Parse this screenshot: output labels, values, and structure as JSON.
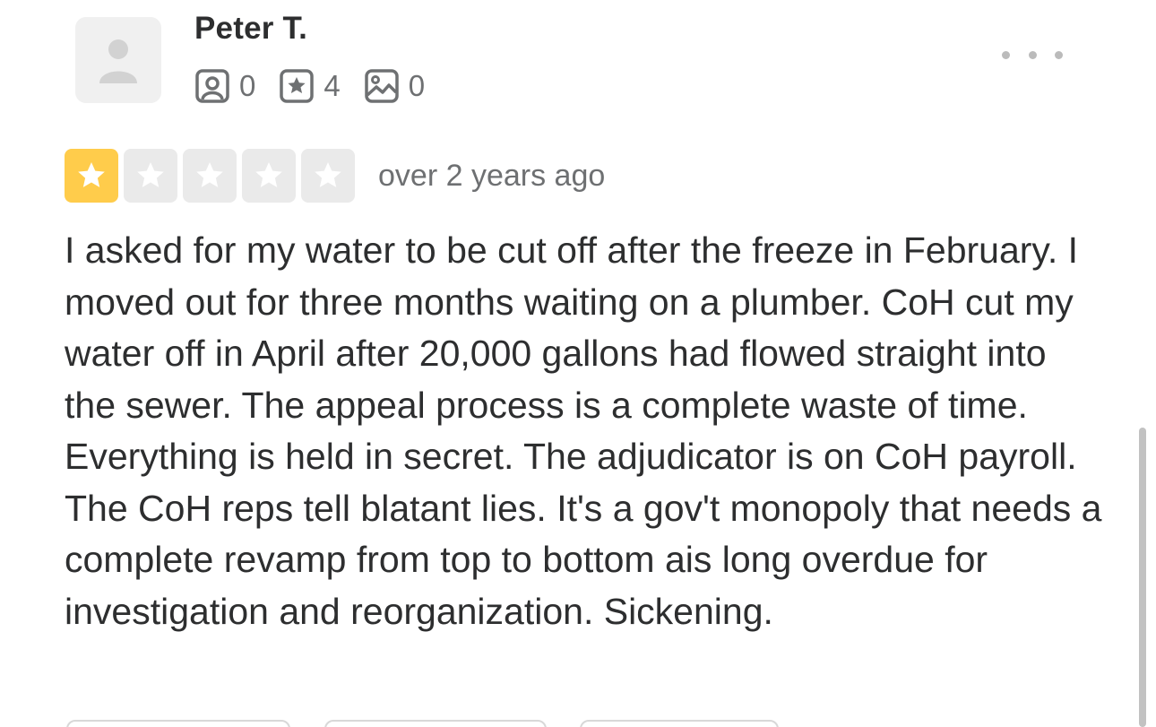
{
  "review": {
    "user": {
      "name": "Peter T.",
      "avatar_icon": "user-placeholder-icon"
    },
    "stats": {
      "friends": {
        "icon": "friends-icon",
        "count": "0"
      },
      "reviews": {
        "icon": "review-star-icon",
        "count": "4"
      },
      "photos": {
        "icon": "photo-icon",
        "count": "0"
      }
    },
    "more_icon": "ellipsis-icon",
    "rating": {
      "value": 1,
      "max": 5,
      "filled_color": "#ffcc4b",
      "empty_color": "#eaeaea"
    },
    "date": "over 2 years ago",
    "text": "I asked for my water to be cut off after the freeze in February.  I moved out for three months waiting on a plumber.  CoH cut my water off in April after 20,000 gallons had flowed straight into the sewer.  The appeal process is a complete waste of time.  Everything is held in secret.  The adjudicator is on CoH payroll.  The CoH reps tell blatant lies.  It's a gov't monopoly that needs a complete revamp from top to bottom ais long overdue for investigation and reorganization.  Sickening."
  }
}
